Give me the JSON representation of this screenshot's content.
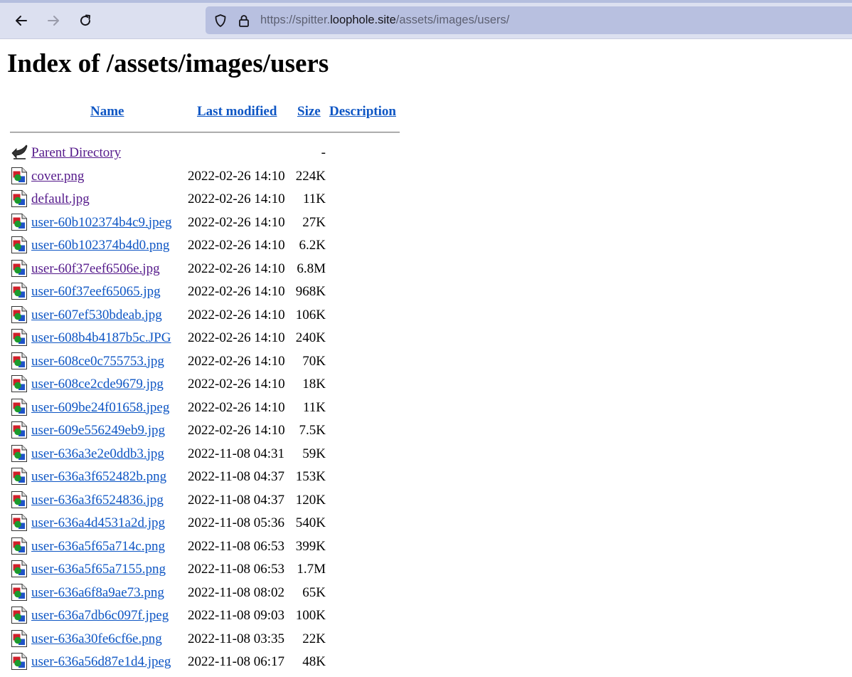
{
  "browser": {
    "url_prefix": "https://spitter.",
    "url_host": "loophole.site",
    "url_path": "/assets/images/users/"
  },
  "page": {
    "title": "Index of /assets/images/users",
    "columns": {
      "name": "Name",
      "last_modified": "Last modified",
      "size": "Size",
      "description": "Description"
    },
    "parent": {
      "name": "Parent Directory",
      "size": "-"
    },
    "files": [
      {
        "name": "cover.png",
        "modified": "2022-02-26 14:10",
        "size": "224K",
        "visited": true
      },
      {
        "name": "default.jpg",
        "modified": "2022-02-26 14:10",
        "size": "11K",
        "visited": true
      },
      {
        "name": "user-60b102374b4c9.jpeg",
        "modified": "2022-02-26 14:10",
        "size": "27K",
        "visited": false
      },
      {
        "name": "user-60b102374b4d0.png",
        "modified": "2022-02-26 14:10",
        "size": "6.2K",
        "visited": false
      },
      {
        "name": "user-60f37eef6506e.jpg",
        "modified": "2022-02-26 14:10",
        "size": "6.8M",
        "visited": true
      },
      {
        "name": "user-60f37eef65065.jpg",
        "modified": "2022-02-26 14:10",
        "size": "968K",
        "visited": false
      },
      {
        "name": "user-607ef530bdeab.jpg",
        "modified": "2022-02-26 14:10",
        "size": "106K",
        "visited": false
      },
      {
        "name": "user-608b4b4187b5c.JPG",
        "modified": "2022-02-26 14:10",
        "size": "240K",
        "visited": false
      },
      {
        "name": "user-608ce0c755753.jpg",
        "modified": "2022-02-26 14:10",
        "size": "70K",
        "visited": false
      },
      {
        "name": "user-608ce2cde9679.jpg",
        "modified": "2022-02-26 14:10",
        "size": "18K",
        "visited": false
      },
      {
        "name": "user-609be24f01658.jpeg",
        "modified": "2022-02-26 14:10",
        "size": "11K",
        "visited": false
      },
      {
        "name": "user-609e556249eb9.jpg",
        "modified": "2022-02-26 14:10",
        "size": "7.5K",
        "visited": false
      },
      {
        "name": "user-636a3e2e0ddb3.jpg",
        "modified": "2022-11-08 04:31",
        "size": "59K",
        "visited": false
      },
      {
        "name": "user-636a3f652482b.png",
        "modified": "2022-11-08 04:37",
        "size": "153K",
        "visited": false
      },
      {
        "name": "user-636a3f6524836.jpg",
        "modified": "2022-11-08 04:37",
        "size": "120K",
        "visited": false
      },
      {
        "name": "user-636a4d4531a2d.jpg",
        "modified": "2022-11-08 05:36",
        "size": "540K",
        "visited": false
      },
      {
        "name": "user-636a5f65a714c.png",
        "modified": "2022-11-08 06:53",
        "size": "399K",
        "visited": false
      },
      {
        "name": "user-636a5f65a7155.png",
        "modified": "2022-11-08 06:53",
        "size": "1.7M",
        "visited": false
      },
      {
        "name": "user-636a6f8a9ae73.png",
        "modified": "2022-11-08 08:02",
        "size": "65K",
        "visited": false
      },
      {
        "name": "user-636a7db6c097f.jpeg",
        "modified": "2022-11-08 09:03",
        "size": "100K",
        "visited": false
      },
      {
        "name": "user-636a30fe6cf6e.png",
        "modified": "2022-11-08 03:35",
        "size": "22K",
        "visited": false
      },
      {
        "name": "user-636a56d87e1d4.jpeg",
        "modified": "2022-11-08 06:17",
        "size": "48K",
        "visited": false
      }
    ]
  },
  "icons": {
    "back": "back-arrow-icon",
    "forward": "forward-arrow-icon",
    "reload": "reload-icon",
    "shield": "shield-icon",
    "lock": "lock-icon",
    "parent": "folder-back-icon",
    "file": "image-file-icon"
  },
  "colors": {
    "link": "#0e56c4",
    "visited": "#551a8b",
    "toolbar": "#dce0f0",
    "urlbar": "#b8c0e0"
  }
}
